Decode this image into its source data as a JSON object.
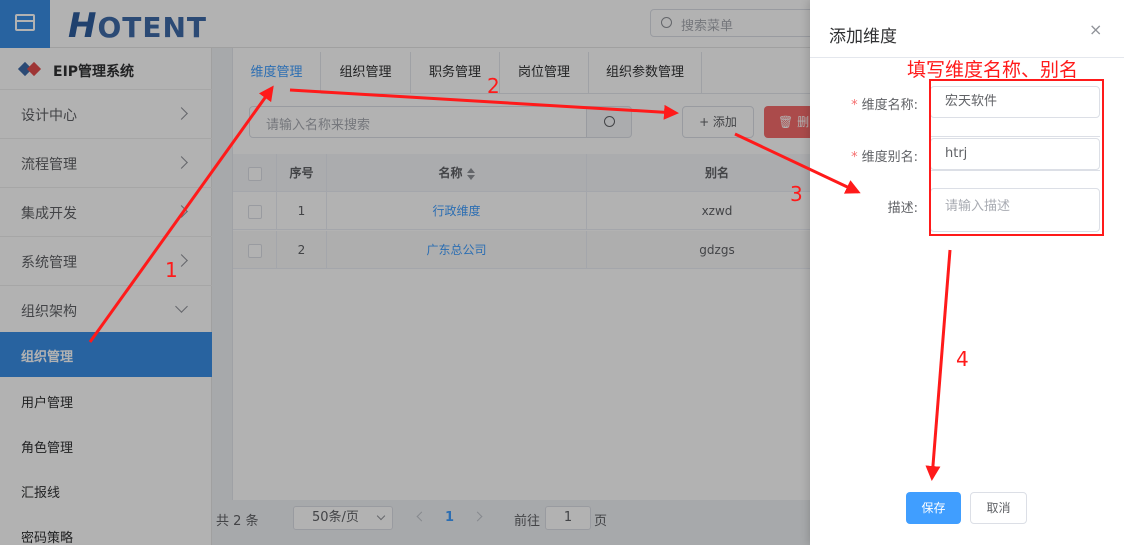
{
  "header": {
    "logo": {
      "first": "H",
      "rest": "OTENT"
    },
    "search_placeholder": "搜索菜单"
  },
  "sidebar": {
    "brand": "EIP管理系统",
    "groups": [
      {
        "label": "设计中心"
      },
      {
        "label": "流程管理"
      },
      {
        "label": "集成开发"
      },
      {
        "label": "系统管理"
      },
      {
        "label": "组织架构"
      }
    ],
    "sub_items": [
      {
        "label": "组织管理",
        "active": true
      },
      {
        "label": "用户管理"
      },
      {
        "label": "角色管理"
      },
      {
        "label": "汇报线"
      },
      {
        "label": "密码策略"
      }
    ]
  },
  "main": {
    "tabs": [
      {
        "label": "维度管理",
        "active": true
      },
      {
        "label": "组织管理"
      },
      {
        "label": "职务管理"
      },
      {
        "label": "岗位管理"
      },
      {
        "label": "组织参数管理"
      }
    ],
    "search_placeholder": "请输入名称来搜索",
    "add_label": "+ 添加",
    "delete_label": "删",
    "table": {
      "columns": [
        "序号",
        "名称",
        "别名"
      ],
      "rows": [
        {
          "index": "1",
          "name": "行政维度",
          "alias": "xzwd"
        },
        {
          "index": "2",
          "name": "广东总公司",
          "alias": "gdzgs"
        }
      ]
    },
    "pagination": {
      "total": "共 2 条",
      "page_size": "50条/页",
      "current_page": "1",
      "goto_label": "前往",
      "goto_value": "1",
      "page_unit": "页"
    }
  },
  "drawer": {
    "title": "添加维度",
    "close": "×",
    "fields": {
      "name_label": "维度名称:",
      "name_value": "宏天软件",
      "alias_label": "维度别名:",
      "alias_value": "htrj",
      "desc_label": "描述:",
      "desc_placeholder": "请输入描述"
    },
    "save_label": "保存",
    "cancel_label": "取消"
  },
  "annotations": {
    "title": "填写维度名称、别名",
    "step1": "1",
    "step2": "2",
    "step3": "3",
    "step4": "4",
    "color": "#ff1a1a"
  },
  "colors": {
    "primary": "#409eff",
    "active_menu": "#3a8ee6",
    "danger": "#f56c6c"
  }
}
